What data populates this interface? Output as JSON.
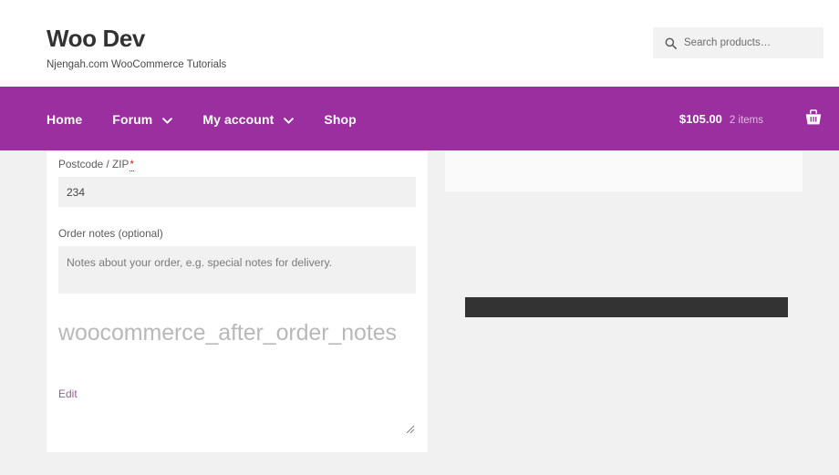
{
  "header": {
    "site_title": "Woo Dev",
    "site_description": "Njengah.com WooCommerce Tutorials",
    "search": {
      "icon": "search-icon",
      "placeholder": "Search products…",
      "value": ""
    }
  },
  "nav": {
    "background_color": "#9c2fa0",
    "items": [
      {
        "label": "Home",
        "has_dropdown": false
      },
      {
        "label": "Forum",
        "has_dropdown": true
      },
      {
        "label": "My account",
        "has_dropdown": true
      },
      {
        "label": "Shop",
        "has_dropdown": false
      }
    ],
    "cart": {
      "amount": "$105.00",
      "count": "2 items",
      "icon": "shopping-basket-icon"
    }
  },
  "checkout": {
    "postcode": {
      "label": "Postcode / ZIP",
      "required_mark": "*",
      "value": "234"
    },
    "order_notes": {
      "label": "Order notes (optional)",
      "placeholder": "Notes about your order, e.g. special notes for delivery.",
      "value": ""
    },
    "hook_heading": "woocommerce_after_order_notes",
    "edit_link": "Edit",
    "place_order_button": {
      "label": "",
      "color": "#333333"
    }
  },
  "colors": {
    "brand_purple": "#9c2fa0",
    "page_background": "#f1f1f1",
    "panel_background": "#ffffff",
    "field_background": "#f1f1f1",
    "required_red": "#b8312f",
    "link_mauve": "#9b5f8e",
    "hook_gray": "#b9b9b9"
  }
}
